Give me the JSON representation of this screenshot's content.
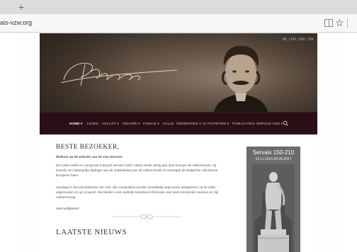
{
  "browser": {
    "newtab_symbol": "+",
    "url": "ais-vzw.org",
    "star_symbol": "☆"
  },
  "hero": {
    "lang_links": "NL | FR | EN | DE"
  },
  "nav": {
    "items": [
      "HOME ▾",
      "LEVEN",
      "CELLIST ▾",
      "OEUVRE ▾",
      "FAMILIE ▾",
      "HALLE",
      "ONDERZOEK ▾",
      "ACTIVITEITEN ▾",
      "PUBLICATIES",
      "SERVAIS VZW ▾"
    ]
  },
  "content": {
    "heading": "BESTE BEZOEKER,",
    "welcome": "Welkom op de website van de vzw Servais!",
    "p1": "De Halse cellist en componist François Servais (1807-1866) reisde dertig jaar door Europa als cellovirtuoos. Hij leverde een belangrijke bijdrage aan de ontwikkeling van de cellotechniek en bezorgde de Belgische celloschool Europese faam.",
    "p2": "Vandaag is Servais bekender dan ooit: zijn composities worden wereldwijd uitgevoerd, aangeleerd, op de radio uitgezonden en op cd gezet. We bieden u een website boordevol informatie over deze beroemde musicus en zijn nalatenschap.",
    "p3": "Veel surfplezier!",
    "news_heading": "LAATSTE NIEUWS"
  },
  "aside": {
    "title": "Servais 150-210",
    "dates": "15.11.2016-03.06.2017"
  },
  "colors": {
    "nav_bg": "#2a1016",
    "aside_bg": "#6b6b6b"
  }
}
